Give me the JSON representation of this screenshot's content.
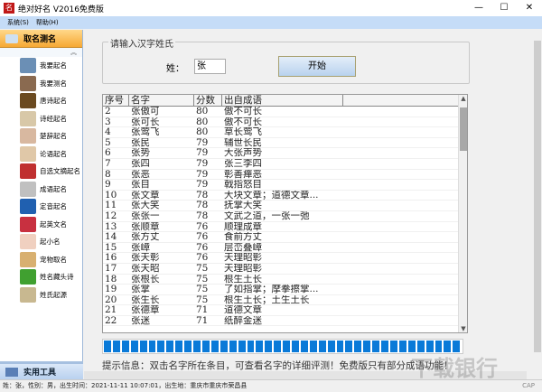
{
  "window": {
    "title": "绝对好名 V2016免费版",
    "minimize": "—",
    "maximize": "☐",
    "close": "✕"
  },
  "menu": [
    "系统(S)",
    "帮助(H)"
  ],
  "sidebar": {
    "header": "取名测名",
    "collapse": "︽",
    "items": [
      "我要起名",
      "我要测名",
      "唐诗起名",
      "诗经起名",
      "楚辞起名",
      "论语起名",
      "自选文摘起名",
      "成语起名",
      "定音起名",
      "起英文名",
      "起小名",
      "宠物取名",
      "姓名藏头诗",
      "姓氏起源"
    ],
    "footer": "实用工具"
  },
  "form": {
    "group_label": "请输入汉字姓氏",
    "surname_label": "姓：",
    "surname_value": "张",
    "start_button": "开始"
  },
  "table": {
    "columns": [
      "序号",
      "名字",
      "分数",
      "出自成语",
      ""
    ],
    "rows": [
      [
        "2",
        "张傲可",
        "80",
        "傲不可长"
      ],
      [
        "3",
        "张可长",
        "80",
        "傲不可长"
      ],
      [
        "4",
        "张莺飞",
        "80",
        "草长莺飞"
      ],
      [
        "5",
        "张民",
        "79",
        "辅世长民"
      ],
      [
        "6",
        "张势",
        "79",
        "大张声势"
      ],
      [
        "7",
        "张四",
        "79",
        "张三李四"
      ],
      [
        "8",
        "张恶",
        "79",
        "彰善瘅恶"
      ],
      [
        "9",
        "张目",
        "79",
        "戟指怒目"
      ],
      [
        "10",
        "张文章",
        "78",
        "大块文章；道德文章..."
      ],
      [
        "11",
        "张大笑",
        "78",
        "抚掌大笑"
      ],
      [
        "12",
        "张张一",
        "78",
        "文武之道，一张一弛"
      ],
      [
        "13",
        "张顺章",
        "76",
        "顺理成章"
      ],
      [
        "14",
        "张方丈",
        "76",
        "食前方丈"
      ],
      [
        "15",
        "张嶂",
        "76",
        "层峦叠嶂"
      ],
      [
        "16",
        "张天彰",
        "76",
        "天理昭彰"
      ],
      [
        "17",
        "张天昭",
        "75",
        "天理昭彰"
      ],
      [
        "18",
        "张根长",
        "75",
        "根生土长"
      ],
      [
        "19",
        "张掌",
        "75",
        "了如指掌；摩拳擦掌..."
      ],
      [
        "20",
        "张生长",
        "75",
        "根生土长；土生土长"
      ],
      [
        "21",
        "张德章",
        "71",
        "道德文章"
      ],
      [
        "22",
        "张迷",
        "71",
        "纸醉金迷"
      ]
    ]
  },
  "progress": {
    "percent": 100,
    "color": "#0a7ad8"
  },
  "tip": "提示信息：双击名字所在条目，可查看名字的详细评测！免费版只有部分成语功能！",
  "status": {
    "text": "姓：张，性别：男，出生时间：2021-11-11 10:07:01，出生地：重庆市重庆市荣昌县",
    "cap": "CAP"
  },
  "watermark": "下载银行"
}
